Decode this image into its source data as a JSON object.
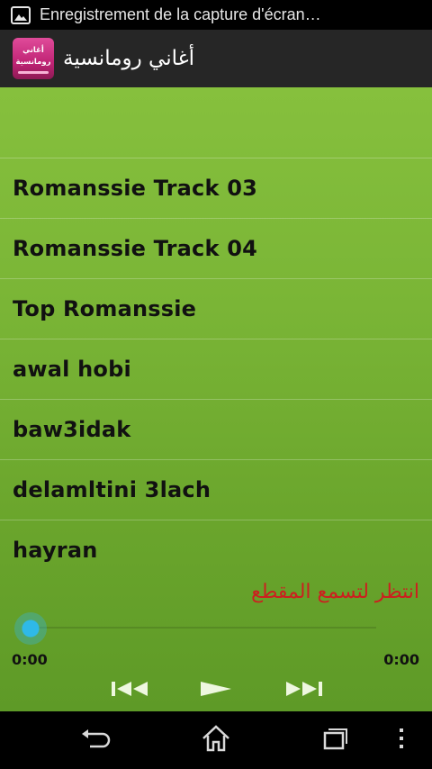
{
  "status_bar": {
    "notification_icon": "image-icon",
    "text": "Enregistrement de la capture d'écran…"
  },
  "action_bar": {
    "app_logo_line1": "أغاني",
    "app_logo_line2": "رومانسية",
    "title": "أغاني رومانسية"
  },
  "tracks": [
    {
      "label": "Romanssie Track 03"
    },
    {
      "label": "Romanssie Track 04"
    },
    {
      "label": "Top Romanssie"
    },
    {
      "label": "awal hobi"
    },
    {
      "label": "baw3idak"
    },
    {
      "label": "delamltini 3lach"
    },
    {
      "label": "hayran"
    }
  ],
  "player": {
    "wait_message": "انتظر لتسمع المقطع",
    "elapsed": "0:00",
    "duration": "0:00",
    "progress": 0,
    "prev_icon": "previous-icon",
    "play_icon": "play-icon",
    "next_icon": "next-icon"
  },
  "nav_bar": {
    "back_icon": "back-icon",
    "home_icon": "home-icon",
    "recent_icon": "recent-apps-icon",
    "menu_icon": "overflow-menu-icon"
  },
  "colors": {
    "content_top": "#86c03d",
    "content_bottom": "#5e9a27",
    "wait_message": "#cc1f1f",
    "seek_thumb": "#33b5e5"
  }
}
